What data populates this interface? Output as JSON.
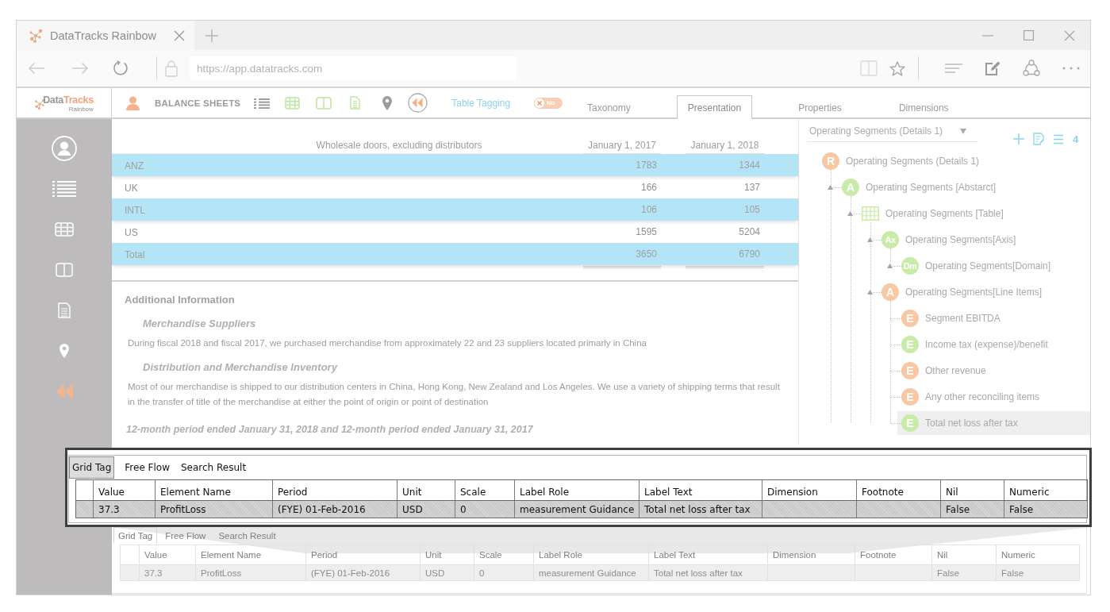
{
  "browser": {
    "tab_title": "DataTracks Rainbow",
    "url": "https://app.datatracks.com"
  },
  "app_header": {
    "logo": {
      "parts": [
        "Data",
        "Tracks"
      ],
      "subtitle": "Rainbow"
    },
    "sheet_title": "BALANCE SHEETS",
    "mode_label": "Table Tagging",
    "toggle": {
      "label": "No",
      "on": false
    },
    "tabs": [
      {
        "label": "Taxonomy",
        "selected": false
      },
      {
        "label": "Presentation",
        "selected": true
      },
      {
        "label": "Properties",
        "selected": false
      },
      {
        "label": "Dimensions",
        "selected": false
      }
    ]
  },
  "statement_table": {
    "heading": "Wholesale doors, excluding distributors",
    "columns": [
      "January 1, 2017",
      "January 1, 2018"
    ],
    "rows": [
      {
        "kind": "item",
        "label": "ANZ",
        "values": [
          "1783",
          "1344"
        ],
        "highlighted": true
      },
      {
        "kind": "item",
        "label": "UK",
        "values": [
          "166",
          "137"
        ],
        "highlighted": false
      },
      {
        "kind": "item",
        "label": "INTL",
        "values": [
          "106",
          "105"
        ],
        "highlighted": true
      },
      {
        "kind": "item",
        "label": "US",
        "values": [
          "1595",
          "5204"
        ],
        "highlighted": false
      },
      {
        "kind": "total",
        "label": "Total",
        "values": [
          "3650",
          "6790"
        ],
        "highlighted": true
      }
    ]
  },
  "additional_information": {
    "title": "Additional Information",
    "sections": [
      {
        "heading": "Merchandise Suppliers",
        "text": "During fiscal 2018 and fiscal 2017, we purchased merchandise from approximately 22 and 23 suppliers located primarly in China"
      },
      {
        "heading": "Distribution and Merchandise Inventory",
        "text": "Most of our merchandise is shipped to our distribution centers in China, Hong Kong, New Zealand and Los Angeles. We use a variety of shipping terms that result in the transfer of title of the merchandise at either the point of origin or point of destination"
      }
    ],
    "period_note": "12-month period ended January 31, 2018 and 12-month period ended January 31, 2017"
  },
  "presentation_panel": {
    "dropdown": "Operating Segments (Details 1)",
    "count": "4",
    "tree": [
      {
        "kind": "badge",
        "badge": "R",
        "color": "#f8c8a5",
        "label": "Operating Segments (Details 1)",
        "expandable": false,
        "selected": false,
        "children": [
          {
            "kind": "badge",
            "badge": "A",
            "color": "#c8eba8",
            "label": "Operating Segments [Abstarct]",
            "expandable": true,
            "selected": false,
            "children": [
              {
                "kind": "table",
                "color": "#c8eba8",
                "label": "Operating Segments [Table]",
                "expandable": true,
                "selected": false,
                "children": [
                  {
                    "kind": "badge",
                    "badge": "Ax",
                    "color": "#c8eba8",
                    "label": "Operating Segments[Axis]",
                    "expandable": true,
                    "selected": false,
                    "children": [
                      {
                        "kind": "badge",
                        "badge": "Dm",
                        "color": "#c8eba8",
                        "label": "Operating Segments[Domain]",
                        "expandable": true,
                        "selected": false
                      }
                    ]
                  },
                  {
                    "kind": "badge",
                    "badge": "A",
                    "color": "#f8c8a5",
                    "label": "Operating Segments[Line Items]",
                    "expandable": true,
                    "selected": false,
                    "children": [
                      {
                        "kind": "badge",
                        "badge": "E",
                        "color": "#f8c8a5",
                        "label": "Segment EBITDA",
                        "expandable": false,
                        "selected": false
                      },
                      {
                        "kind": "badge",
                        "badge": "E",
                        "color": "#c8eba8",
                        "label": "Income tax (expense)/benefit",
                        "expandable": false,
                        "selected": false
                      },
                      {
                        "kind": "badge",
                        "badge": "E",
                        "color": "#f8c8a5",
                        "label": "Other revenue",
                        "expandable": false,
                        "selected": false
                      },
                      {
                        "kind": "badge",
                        "badge": "E",
                        "color": "#f8c8a5",
                        "label": "Any other reconciling items",
                        "expandable": false,
                        "selected": false
                      },
                      {
                        "kind": "badge",
                        "badge": "E",
                        "color": "#c8eba8",
                        "label": "Total net loss after tax",
                        "expandable": false,
                        "selected": true
                      }
                    ]
                  }
                ]
              }
            ]
          }
        ]
      }
    ]
  },
  "grid_panel": {
    "tabs": [
      {
        "label": "Grid Tag",
        "selected": true
      },
      {
        "label": "Free Flow",
        "selected": false
      },
      {
        "label": "Search Result",
        "selected": false
      }
    ],
    "columns": [
      "Value",
      "Element Name",
      "Period",
      "Unit",
      "Scale",
      "Label Role",
      "Label Text",
      "Dimension",
      "Footnote",
      "Nil",
      "Numeric"
    ],
    "rows": [
      {
        "selected": true,
        "cells": [
          "37.3",
          "ProfitLoss",
          "(FYE) 01-Feb-2016",
          "USD",
          "0",
          "measurement Guidance",
          "Total net loss after tax",
          null,
          null,
          "False",
          "False"
        ]
      }
    ]
  },
  "magnified_grid": {
    "tabs": [
      {
        "label": "Grid Tag",
        "selected": true
      },
      {
        "label": "Free Flow",
        "selected": false
      },
      {
        "label": "Search Result",
        "selected": false
      }
    ],
    "columns": [
      "Value",
      "Element Name",
      "Period",
      "Unit",
      "Scale",
      "Label Role",
      "Label Text",
      "Dimension",
      "Footnote",
      "Nil",
      "Numeric"
    ],
    "rows": [
      {
        "selected": true,
        "cells": [
          "37.3",
          "ProfitLoss",
          "(FYE) 01-Feb-2016",
          "USD",
          "0",
          "measurement Guidance",
          "Total net loss after tax",
          null,
          null,
          "False",
          "False"
        ]
      }
    ]
  }
}
